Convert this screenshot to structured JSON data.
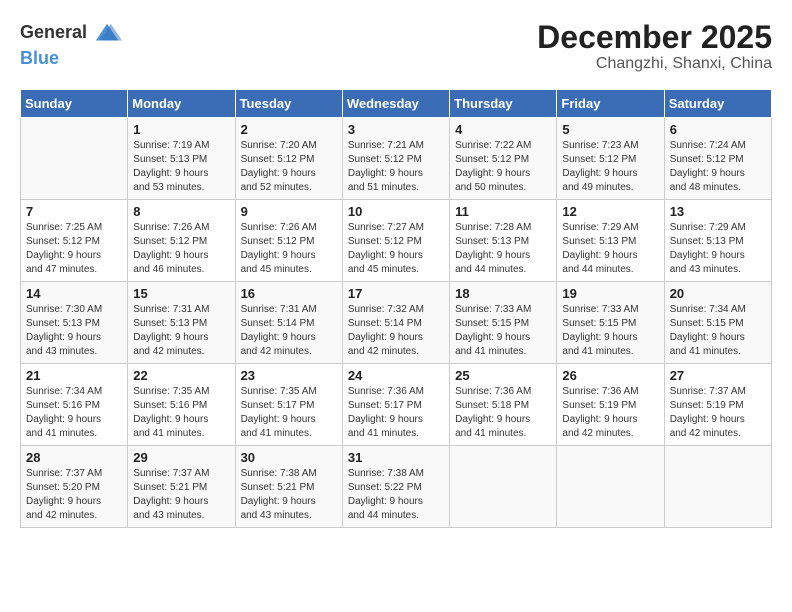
{
  "header": {
    "logo_general": "General",
    "logo_blue": "Blue",
    "month": "December 2025",
    "location": "Changzhi, Shanxi, China"
  },
  "weekdays": [
    "Sunday",
    "Monday",
    "Tuesday",
    "Wednesday",
    "Thursday",
    "Friday",
    "Saturday"
  ],
  "weeks": [
    [
      {
        "day": "",
        "info": ""
      },
      {
        "day": "1",
        "info": "Sunrise: 7:19 AM\nSunset: 5:13 PM\nDaylight: 9 hours\nand 53 minutes."
      },
      {
        "day": "2",
        "info": "Sunrise: 7:20 AM\nSunset: 5:12 PM\nDaylight: 9 hours\nand 52 minutes."
      },
      {
        "day": "3",
        "info": "Sunrise: 7:21 AM\nSunset: 5:12 PM\nDaylight: 9 hours\nand 51 minutes."
      },
      {
        "day": "4",
        "info": "Sunrise: 7:22 AM\nSunset: 5:12 PM\nDaylight: 9 hours\nand 50 minutes."
      },
      {
        "day": "5",
        "info": "Sunrise: 7:23 AM\nSunset: 5:12 PM\nDaylight: 9 hours\nand 49 minutes."
      },
      {
        "day": "6",
        "info": "Sunrise: 7:24 AM\nSunset: 5:12 PM\nDaylight: 9 hours\nand 48 minutes."
      }
    ],
    [
      {
        "day": "7",
        "info": "Sunrise: 7:25 AM\nSunset: 5:12 PM\nDaylight: 9 hours\nand 47 minutes."
      },
      {
        "day": "8",
        "info": "Sunrise: 7:26 AM\nSunset: 5:12 PM\nDaylight: 9 hours\nand 46 minutes."
      },
      {
        "day": "9",
        "info": "Sunrise: 7:26 AM\nSunset: 5:12 PM\nDaylight: 9 hours\nand 45 minutes."
      },
      {
        "day": "10",
        "info": "Sunrise: 7:27 AM\nSunset: 5:12 PM\nDaylight: 9 hours\nand 45 minutes."
      },
      {
        "day": "11",
        "info": "Sunrise: 7:28 AM\nSunset: 5:13 PM\nDaylight: 9 hours\nand 44 minutes."
      },
      {
        "day": "12",
        "info": "Sunrise: 7:29 AM\nSunset: 5:13 PM\nDaylight: 9 hours\nand 44 minutes."
      },
      {
        "day": "13",
        "info": "Sunrise: 7:29 AM\nSunset: 5:13 PM\nDaylight: 9 hours\nand 43 minutes."
      }
    ],
    [
      {
        "day": "14",
        "info": "Sunrise: 7:30 AM\nSunset: 5:13 PM\nDaylight: 9 hours\nand 43 minutes."
      },
      {
        "day": "15",
        "info": "Sunrise: 7:31 AM\nSunset: 5:13 PM\nDaylight: 9 hours\nand 42 minutes."
      },
      {
        "day": "16",
        "info": "Sunrise: 7:31 AM\nSunset: 5:14 PM\nDaylight: 9 hours\nand 42 minutes."
      },
      {
        "day": "17",
        "info": "Sunrise: 7:32 AM\nSunset: 5:14 PM\nDaylight: 9 hours\nand 42 minutes."
      },
      {
        "day": "18",
        "info": "Sunrise: 7:33 AM\nSunset: 5:15 PM\nDaylight: 9 hours\nand 41 minutes."
      },
      {
        "day": "19",
        "info": "Sunrise: 7:33 AM\nSunset: 5:15 PM\nDaylight: 9 hours\nand 41 minutes."
      },
      {
        "day": "20",
        "info": "Sunrise: 7:34 AM\nSunset: 5:15 PM\nDaylight: 9 hours\nand 41 minutes."
      }
    ],
    [
      {
        "day": "21",
        "info": "Sunrise: 7:34 AM\nSunset: 5:16 PM\nDaylight: 9 hours\nand 41 minutes."
      },
      {
        "day": "22",
        "info": "Sunrise: 7:35 AM\nSunset: 5:16 PM\nDaylight: 9 hours\nand 41 minutes."
      },
      {
        "day": "23",
        "info": "Sunrise: 7:35 AM\nSunset: 5:17 PM\nDaylight: 9 hours\nand 41 minutes."
      },
      {
        "day": "24",
        "info": "Sunrise: 7:36 AM\nSunset: 5:17 PM\nDaylight: 9 hours\nand 41 minutes."
      },
      {
        "day": "25",
        "info": "Sunrise: 7:36 AM\nSunset: 5:18 PM\nDaylight: 9 hours\nand 41 minutes."
      },
      {
        "day": "26",
        "info": "Sunrise: 7:36 AM\nSunset: 5:19 PM\nDaylight: 9 hours\nand 42 minutes."
      },
      {
        "day": "27",
        "info": "Sunrise: 7:37 AM\nSunset: 5:19 PM\nDaylight: 9 hours\nand 42 minutes."
      }
    ],
    [
      {
        "day": "28",
        "info": "Sunrise: 7:37 AM\nSunset: 5:20 PM\nDaylight: 9 hours\nand 42 minutes."
      },
      {
        "day": "29",
        "info": "Sunrise: 7:37 AM\nSunset: 5:21 PM\nDaylight: 9 hours\nand 43 minutes."
      },
      {
        "day": "30",
        "info": "Sunrise: 7:38 AM\nSunset: 5:21 PM\nDaylight: 9 hours\nand 43 minutes."
      },
      {
        "day": "31",
        "info": "Sunrise: 7:38 AM\nSunset: 5:22 PM\nDaylight: 9 hours\nand 44 minutes."
      },
      {
        "day": "",
        "info": ""
      },
      {
        "day": "",
        "info": ""
      },
      {
        "day": "",
        "info": ""
      }
    ]
  ]
}
